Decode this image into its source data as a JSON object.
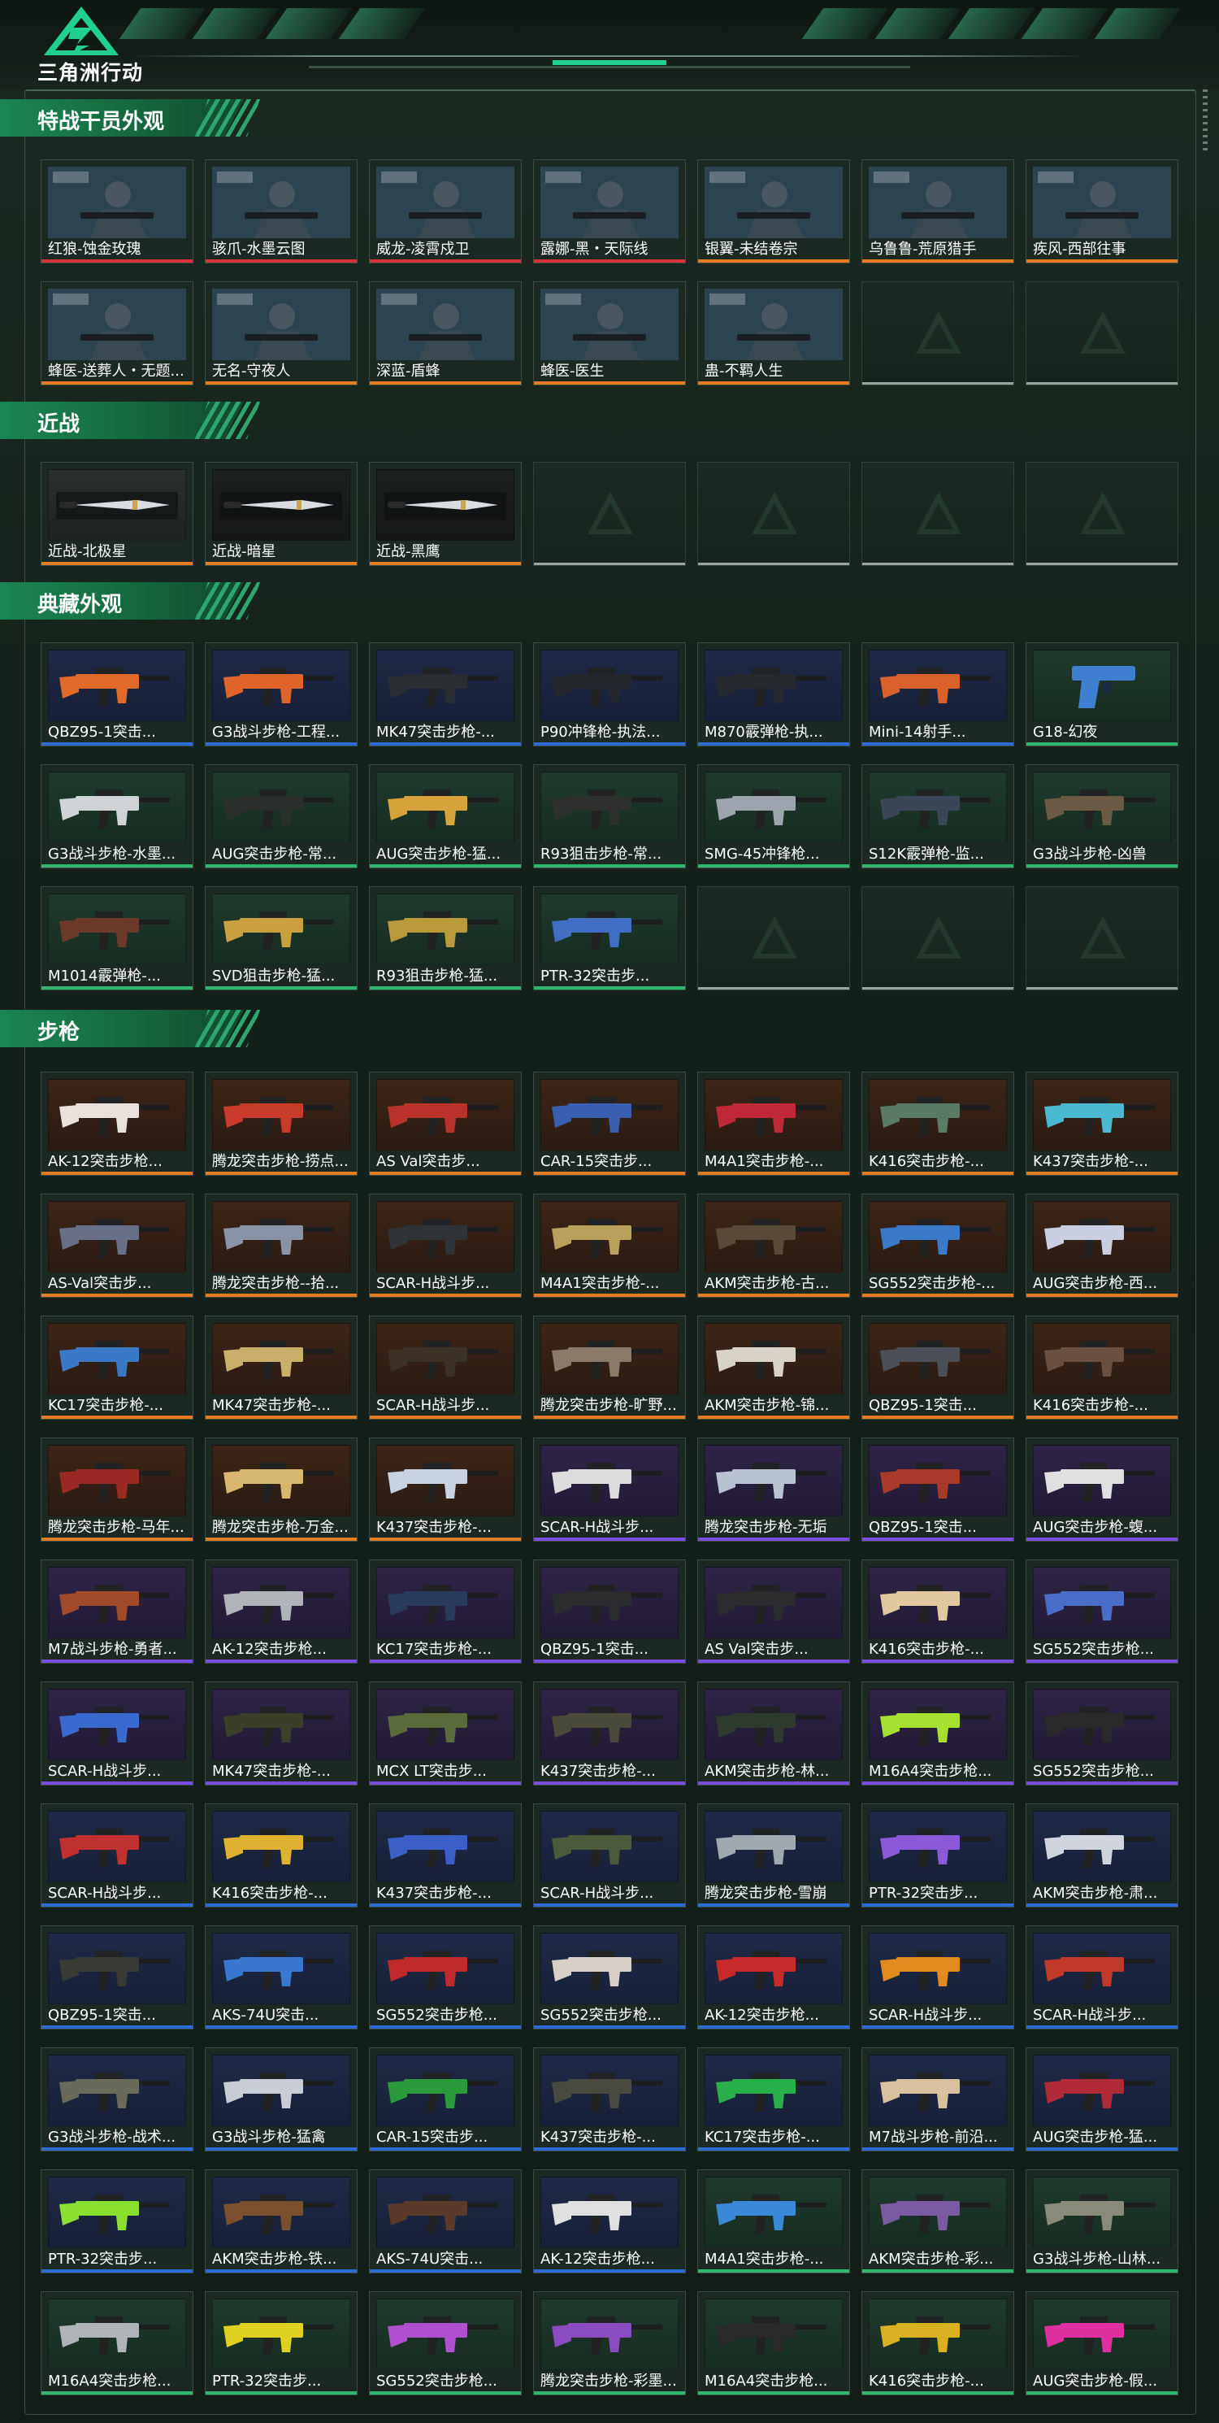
{
  "header": {
    "logo_text": "三角洲行动",
    "logo_icon": "delta-force-logo-icon",
    "accent_color": "#1fd08f"
  },
  "rarity_colors": {
    "red": "#d8323a",
    "orange": "#e57b23",
    "purple": "#7b4de0",
    "blue": "#2f6bd6",
    "green": "#2fb86f",
    "gray": "#9aa5a0"
  },
  "sections": [
    {
      "title": "特战干员外观",
      "items": [
        {
          "label": "红狼-蚀金玫瑰",
          "rarity": "red",
          "theme": "orange",
          "kind": "operator"
        },
        {
          "label": "骇爪-水墨云图",
          "rarity": "red",
          "theme": "gray",
          "kind": "operator"
        },
        {
          "label": "威龙-凌霄戍卫",
          "rarity": "red",
          "theme": "blue",
          "kind": "operator"
        },
        {
          "label": "露娜-黑・天际线",
          "rarity": "red",
          "theme": "blue",
          "kind": "operator"
        },
        {
          "label": "银翼-未结卷宗",
          "rarity": "orange",
          "theme": "green",
          "kind": "operator"
        },
        {
          "label": "乌鲁鲁-荒原猎手",
          "rarity": "orange",
          "theme": "orange",
          "kind": "operator"
        },
        {
          "label": "疾风-西部往事",
          "rarity": "orange",
          "theme": "green",
          "kind": "operator"
        },
        {
          "label": "蜂医-送葬人・无题...",
          "rarity": "orange",
          "theme": "blue",
          "kind": "operator"
        },
        {
          "label": "无名-守夜人",
          "rarity": "orange",
          "theme": "gray",
          "kind": "operator"
        },
        {
          "label": "深蓝-盾蜂",
          "rarity": "orange",
          "theme": "green",
          "kind": "operator"
        },
        {
          "label": "蜂医-医生",
          "rarity": "orange",
          "theme": "blue",
          "kind": "operator"
        },
        {
          "label": "蛊-不羁人生",
          "rarity": "orange",
          "theme": "purple",
          "kind": "operator"
        },
        {
          "label": "",
          "empty": true
        },
        {
          "label": "",
          "empty": true
        }
      ]
    },
    {
      "title": "近战",
      "items": [
        {
          "label": "近战-北极星",
          "rarity": "orange",
          "theme": "gray",
          "kind": "knife"
        },
        {
          "label": "近战-暗星",
          "rarity": "orange",
          "theme": "dark",
          "kind": "knife"
        },
        {
          "label": "近战-黑鹰",
          "rarity": "orange",
          "theme": "dark",
          "kind": "knife"
        },
        {
          "label": "",
          "empty": true
        },
        {
          "label": "",
          "empty": true
        },
        {
          "label": "",
          "empty": true
        },
        {
          "label": "",
          "empty": true
        }
      ]
    },
    {
      "title": "典藏外观",
      "items": [
        {
          "label": "QBZ95-1突击...",
          "rarity": "blue",
          "theme": "blue",
          "kind": "gun",
          "gun_color": "#e06a2a"
        },
        {
          "label": "G3战斗步枪-工程...",
          "rarity": "blue",
          "theme": "blue",
          "kind": "gun",
          "gun_color": "#e0642a"
        },
        {
          "label": "MK47突击步枪-...",
          "rarity": "blue",
          "theme": "blue",
          "kind": "gun",
          "gun_color": "#2a2e33"
        },
        {
          "label": "P90冲锋枪-执法...",
          "rarity": "blue",
          "theme": "blue",
          "kind": "gun",
          "gun_color": "#24272b"
        },
        {
          "label": "M870霰弹枪-执...",
          "rarity": "blue",
          "theme": "blue",
          "kind": "gun",
          "gun_color": "#26292d"
        },
        {
          "label": "Mini-14射手...",
          "rarity": "blue",
          "theme": "blue",
          "kind": "gun",
          "gun_color": "#d9622c"
        },
        {
          "label": "G18-幻夜",
          "rarity": "green",
          "theme": "green",
          "kind": "pistol",
          "gun_color": "#3e7fd0"
        },
        {
          "label": "G3战斗步枪-水墨...",
          "rarity": "green",
          "theme": "green",
          "kind": "gun",
          "gun_color": "#cfd3d6"
        },
        {
          "label": "AUG突击步枪-常...",
          "rarity": "green",
          "theme": "green",
          "kind": "gun",
          "gun_color": "#2b2f2b"
        },
        {
          "label": "AUG突击步枪-猛...",
          "rarity": "green",
          "theme": "green",
          "kind": "gun",
          "gun_color": "#d6a43a"
        },
        {
          "label": "R93狙击步枪-常...",
          "rarity": "green",
          "theme": "green",
          "kind": "gun",
          "gun_color": "#2d302d"
        },
        {
          "label": "SMG-45冲锋枪...",
          "rarity": "green",
          "theme": "green",
          "kind": "gun",
          "gun_color": "#9ea4ad"
        },
        {
          "label": "S12K霰弹枪-监...",
          "rarity": "green",
          "theme": "green",
          "kind": "gun",
          "gun_color": "#3a4556"
        },
        {
          "label": "G3战斗步枪-凶兽",
          "rarity": "green",
          "theme": "green",
          "kind": "gun",
          "gun_color": "#6b5a45"
        },
        {
          "label": "M1014霰弹枪-...",
          "rarity": "green",
          "theme": "green",
          "kind": "gun",
          "gun_color": "#6b3a2a"
        },
        {
          "label": "SVD狙击步枪-猛...",
          "rarity": "green",
          "theme": "green",
          "kind": "gun",
          "gun_color": "#c9a040"
        },
        {
          "label": "R93狙击步枪-猛...",
          "rarity": "green",
          "theme": "green",
          "kind": "gun",
          "gun_color": "#b89a3a"
        },
        {
          "label": "PTR-32突击步...",
          "rarity": "green",
          "theme": "green",
          "kind": "gun",
          "gun_color": "#3f6ec2"
        },
        {
          "label": "",
          "empty": true
        },
        {
          "label": "",
          "empty": true
        },
        {
          "label": "",
          "empty": true
        }
      ]
    },
    {
      "title": "步枪",
      "items": [
        {
          "label": "AK-12突击步枪...",
          "rarity": "orange",
          "theme": "orange",
          "kind": "gun",
          "gun_color": "#e9e2dc"
        },
        {
          "label": "腾龙突击步枪-捞点...",
          "rarity": "orange",
          "theme": "orange",
          "kind": "gun",
          "gun_color": "#c83a2a"
        },
        {
          "label": "AS Val突击步...",
          "rarity": "orange",
          "theme": "orange",
          "kind": "gun",
          "gun_color": "#b8322a"
        },
        {
          "label": "CAR-15突击步...",
          "rarity": "orange",
          "theme": "orange",
          "kind": "gun",
          "gun_color": "#3a5fb0"
        },
        {
          "label": "M4A1突击步枪-...",
          "rarity": "orange",
          "theme": "orange",
          "kind": "gun",
          "gun_color": "#c0283a"
        },
        {
          "label": "K416突击步枪-...",
          "rarity": "orange",
          "theme": "orange",
          "kind": "gun",
          "gun_color": "#5a7a66"
        },
        {
          "label": "K437突击步枪-...",
          "rarity": "orange",
          "theme": "orange",
          "kind": "gun",
          "gun_color": "#4ab8d0"
        },
        {
          "label": "AS-Val突击步...",
          "rarity": "orange",
          "theme": "orange",
          "kind": "gun",
          "gun_color": "#6a6f88"
        },
        {
          "label": "腾龙突击步枪--拾...",
          "rarity": "orange",
          "theme": "orange",
          "kind": "gun",
          "gun_color": "#8a93a5"
        },
        {
          "label": "SCAR-H战斗步...",
          "rarity": "orange",
          "theme": "orange",
          "kind": "gun",
          "gun_color": "#2f3236"
        },
        {
          "label": "M4A1突击步枪-...",
          "rarity": "orange",
          "theme": "orange",
          "kind": "gun",
          "gun_color": "#b8a15a"
        },
        {
          "label": "AKM突击步枪-古...",
          "rarity": "orange",
          "theme": "orange",
          "kind": "gun",
          "gun_color": "#5a4a3a"
        },
        {
          "label": "SG552突击步枪-...",
          "rarity": "orange",
          "theme": "orange",
          "kind": "gun",
          "gun_color": "#3a7ac8"
        },
        {
          "label": "AUG突击步枪-西...",
          "rarity": "orange",
          "theme": "orange",
          "kind": "gun",
          "gun_color": "#c9cfe0"
        },
        {
          "label": "KC17突击步枪-...",
          "rarity": "orange",
          "theme": "orange",
          "kind": "gun",
          "gun_color": "#3a78c8"
        },
        {
          "label": "MK47突击步枪-...",
          "rarity": "orange",
          "theme": "orange",
          "kind": "gun",
          "gun_color": "#c9b06a"
        },
        {
          "label": "SCAR-H战斗步...",
          "rarity": "orange",
          "theme": "orange",
          "kind": "gun",
          "gun_color": "#3a3024"
        },
        {
          "label": "腾龙突击步枪-旷野...",
          "rarity": "orange",
          "theme": "orange",
          "kind": "gun",
          "gun_color": "#8a7a6a"
        },
        {
          "label": "AKM突击步枪-锦...",
          "rarity": "orange",
          "theme": "orange",
          "kind": "gun",
          "gun_color": "#d8d2c8"
        },
        {
          "label": "QBZ95-1突击...",
          "rarity": "orange",
          "theme": "orange",
          "kind": "gun",
          "gun_color": "#4a4f58"
        },
        {
          "label": "K416突击步枪-...",
          "rarity": "orange",
          "theme": "orange",
          "kind": "gun",
          "gun_color": "#6a5040"
        },
        {
          "label": "腾龙突击步枪-马年...",
          "rarity": "orange",
          "theme": "orange",
          "kind": "gun",
          "gun_color": "#9a2a24"
        },
        {
          "label": "腾龙突击步枪-万金...",
          "rarity": "orange",
          "theme": "orange",
          "kind": "gun",
          "gun_color": "#d8b870"
        },
        {
          "label": "K437突击步枪-...",
          "rarity": "orange",
          "theme": "orange",
          "kind": "gun",
          "gun_color": "#c8d2e0"
        },
        {
          "label": "SCAR-H战斗步...",
          "rarity": "purple",
          "theme": "purple",
          "kind": "gun",
          "gun_color": "#dcdcdc"
        },
        {
          "label": "腾龙突击步枪-无垢",
          "rarity": "purple",
          "theme": "purple",
          "kind": "gun",
          "gun_color": "#b8c2d0"
        },
        {
          "label": "QBZ95-1突击...",
          "rarity": "purple",
          "theme": "purple",
          "kind": "gun",
          "gun_color": "#a83a2a"
        },
        {
          "label": "AUG突击步枪-蝮...",
          "rarity": "purple",
          "theme": "purple",
          "kind": "gun",
          "gun_color": "#e0e0e0"
        },
        {
          "label": "M7战斗步枪-勇者...",
          "rarity": "purple",
          "theme": "purple",
          "kind": "gun",
          "gun_color": "#a04a2a"
        },
        {
          "label": "AK-12突击步枪...",
          "rarity": "purple",
          "theme": "purple",
          "kind": "gun",
          "gun_color": "#b0b4b8"
        },
        {
          "label": "KC17突击步枪-...",
          "rarity": "purple",
          "theme": "purple",
          "kind": "gun",
          "gun_color": "#2a3a5a"
        },
        {
          "label": "QBZ95-1突击...",
          "rarity": "purple",
          "theme": "purple",
          "kind": "gun",
          "gun_color": "#2a2c2e"
        },
        {
          "label": "AS Val突击步...",
          "rarity": "purple",
          "theme": "purple",
          "kind": "gun",
          "gun_color": "#2a2c2e"
        },
        {
          "label": "K416突击步枪-...",
          "rarity": "purple",
          "theme": "purple",
          "kind": "gun",
          "gun_color": "#e0c8a0"
        },
        {
          "label": "SG552突击步枪...",
          "rarity": "purple",
          "theme": "purple",
          "kind": "gun",
          "gun_color": "#4a6ec8"
        },
        {
          "label": "SCAR-H战斗步...",
          "rarity": "purple",
          "theme": "purple",
          "kind": "gun",
          "gun_color": "#3a6ad0"
        },
        {
          "label": "MK47突击步枪-...",
          "rarity": "purple",
          "theme": "purple",
          "kind": "gun",
          "gun_color": "#3a3f2a"
        },
        {
          "label": "MCX LT突击步...",
          "rarity": "purple",
          "theme": "purple",
          "kind": "gun",
          "gun_color": "#5a6a3a"
        },
        {
          "label": "K437突击步枪-...",
          "rarity": "purple",
          "theme": "purple",
          "kind": "gun",
          "gun_color": "#4a4a3a"
        },
        {
          "label": "AKM突击步枪-林...",
          "rarity": "purple",
          "theme": "purple",
          "kind": "gun",
          "gun_color": "#2f3a2f"
        },
        {
          "label": "M16A4突击步枪...",
          "rarity": "purple",
          "theme": "purple",
          "kind": "gun",
          "gun_color": "#a8e030"
        },
        {
          "label": "SG552突击步枪...",
          "rarity": "purple",
          "theme": "purple",
          "kind": "gun",
          "gun_color": "#2a2a2a"
        },
        {
          "label": "SCAR-H战斗步...",
          "rarity": "blue",
          "theme": "blue",
          "kind": "gun",
          "gun_color": "#c03030"
        },
        {
          "label": "K416突击步枪-...",
          "rarity": "blue",
          "theme": "blue",
          "kind": "gun",
          "gun_color": "#e0b030"
        },
        {
          "label": "K437突击步枪-...",
          "rarity": "blue",
          "theme": "blue",
          "kind": "gun",
          "gun_color": "#3a60c8"
        },
        {
          "label": "SCAR-H战斗步...",
          "rarity": "blue",
          "theme": "blue",
          "kind": "gun",
          "gun_color": "#4a5a3a"
        },
        {
          "label": "腾龙突击步枪-雪崩",
          "rarity": "blue",
          "theme": "blue",
          "kind": "gun",
          "gun_color": "#a0a8b0"
        },
        {
          "label": "PTR-32突击步...",
          "rarity": "blue",
          "theme": "blue",
          "kind": "gun",
          "gun_color": "#8a5ad8"
        },
        {
          "label": "AKM突击步枪-肃...",
          "rarity": "blue",
          "theme": "blue",
          "kind": "gun",
          "gun_color": "#d0d4dc"
        },
        {
          "label": "QBZ95-1突击...",
          "rarity": "blue",
          "theme": "blue",
          "kind": "gun",
          "gun_color": "#3a3a34"
        },
        {
          "label": "AKS-74U突击...",
          "rarity": "blue",
          "theme": "blue",
          "kind": "gun",
          "gun_color": "#3a78d0"
        },
        {
          "label": "SG552突击步枪...",
          "rarity": "blue",
          "theme": "blue",
          "kind": "gun",
          "gun_color": "#c02a2a"
        },
        {
          "label": "SG552突击步枪...",
          "rarity": "blue",
          "theme": "blue",
          "kind": "gun",
          "gun_color": "#d8d0c8"
        },
        {
          "label": "AK-12突击步枪...",
          "rarity": "blue",
          "theme": "blue",
          "kind": "gun",
          "gun_color": "#c82a2a"
        },
        {
          "label": "SCAR-H战斗步...",
          "rarity": "blue",
          "theme": "blue",
          "kind": "gun",
          "gun_color": "#e08a20"
        },
        {
          "label": "SCAR-H战斗步...",
          "rarity": "blue",
          "theme": "blue",
          "kind": "gun",
          "gun_color": "#c03a2a"
        },
        {
          "label": "G3战斗步枪-战术...",
          "rarity": "blue",
          "theme": "blue",
          "kind": "gun",
          "gun_color": "#6a6a5a"
        },
        {
          "label": "G3战斗步枪-猛禽",
          "rarity": "blue",
          "theme": "blue",
          "kind": "gun",
          "gun_color": "#c8ccd4"
        },
        {
          "label": "CAR-15突击步...",
          "rarity": "blue",
          "theme": "blue",
          "kind": "gun",
          "gun_color": "#2a9a3a"
        },
        {
          "label": "K437突击步枪-...",
          "rarity": "blue",
          "theme": "blue",
          "kind": "gun",
          "gun_color": "#4a4a40"
        },
        {
          "label": "KC17突击步枪-...",
          "rarity": "blue",
          "theme": "blue",
          "kind": "gun",
          "gun_color": "#2ab04a"
        },
        {
          "label": "M7战斗步枪-前沿...",
          "rarity": "blue",
          "theme": "blue",
          "kind": "gun",
          "gun_color": "#d8c0a0"
        },
        {
          "label": "AUG突击步枪-猛...",
          "rarity": "blue",
          "theme": "blue",
          "kind": "gun",
          "gun_color": "#b02a3a"
        },
        {
          "label": "PTR-32突击步...",
          "rarity": "blue",
          "theme": "blue",
          "kind": "gun",
          "gun_color": "#8ae030"
        },
        {
          "label": "AKM突击步枪-铁...",
          "rarity": "blue",
          "theme": "blue",
          "kind": "gun",
          "gun_color": "#7a5030"
        },
        {
          "label": "AKS-74U突击...",
          "rarity": "blue",
          "theme": "blue",
          "kind": "gun",
          "gun_color": "#5a3a2a"
        },
        {
          "label": "AK-12突击步枪...",
          "rarity": "blue",
          "theme": "blue",
          "kind": "gun",
          "gun_color": "#e0e0e0"
        },
        {
          "label": "M4A1突击步枪-...",
          "rarity": "green",
          "theme": "green",
          "kind": "gun",
          "gun_color": "#3a88d8"
        },
        {
          "label": "AKM突击步枪-彩...",
          "rarity": "green",
          "theme": "green",
          "kind": "gun",
          "gun_color": "#7a5aa0"
        },
        {
          "label": "G3战斗步枪-山林...",
          "rarity": "green",
          "theme": "green",
          "kind": "gun",
          "gun_color": "#8a8a7a"
        },
        {
          "label": "M16A4突击步枪...",
          "rarity": "green",
          "theme": "green",
          "kind": "gun",
          "gun_color": "#b0b4b8"
        },
        {
          "label": "PTR-32突击步...",
          "rarity": "green",
          "theme": "green",
          "kind": "gun",
          "gun_color": "#e0d020"
        },
        {
          "label": "SG552突击步枪...",
          "rarity": "green",
          "theme": "green",
          "kind": "gun",
          "gun_color": "#b050d0"
        },
        {
          "label": "腾龙突击步枪-彩墨...",
          "rarity": "green",
          "theme": "green",
          "kind": "gun",
          "gun_color": "#8a4ac0"
        },
        {
          "label": "M16A4突击步枪...",
          "rarity": "green",
          "theme": "green",
          "kind": "gun",
          "gun_color": "#2a2a2a"
        },
        {
          "label": "K416突击步枪-...",
          "rarity": "green",
          "theme": "green",
          "kind": "gun",
          "gun_color": "#d8b020"
        },
        {
          "label": "AUG突击步枪-假...",
          "rarity": "green",
          "theme": "green",
          "kind": "gun",
          "gun_color": "#e030a0"
        }
      ]
    }
  ]
}
